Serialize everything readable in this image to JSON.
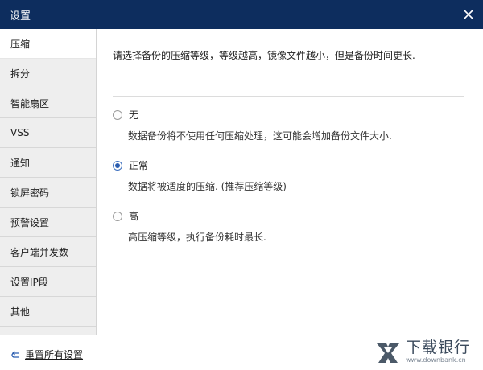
{
  "window": {
    "title": "设置",
    "close_label": "×"
  },
  "sidebar": {
    "items": [
      {
        "label": "压缩",
        "active": true
      },
      {
        "label": "拆分"
      },
      {
        "label": "智能扇区"
      },
      {
        "label": "VSS"
      },
      {
        "label": "通知"
      },
      {
        "label": "锁屏密码"
      },
      {
        "label": "预警设置"
      },
      {
        "label": "客户端并发数"
      },
      {
        "label": "设置IP段"
      },
      {
        "label": "其他"
      }
    ]
  },
  "main": {
    "description": "请选择备份的压缩等级，等级越高，镜像文件越小，但是备份时间更长.",
    "options": [
      {
        "label": "无",
        "description": "数据备份将不使用任何压缩处理，这可能会增加备份文件大小.",
        "selected": false
      },
      {
        "label": "正常",
        "description": "数据将被适度的压缩. (推荐压缩等级)",
        "selected": true
      },
      {
        "label": "高",
        "description": "高压缩等级，执行备份耗时最长.",
        "selected": false
      }
    ]
  },
  "footer": {
    "reset_label": "重置所有设置",
    "watermark_title": "下载银行",
    "watermark_url": "www.downbank.cn"
  },
  "colors": {
    "titlebar": "#0d2d5e",
    "sidebar_bg": "#eeeeee",
    "radio_checked": "#2a5db0"
  },
  "icons": {
    "close": "close-icon",
    "reset": "undo-arrow-icon",
    "watermark": "downbank-logo-icon"
  }
}
